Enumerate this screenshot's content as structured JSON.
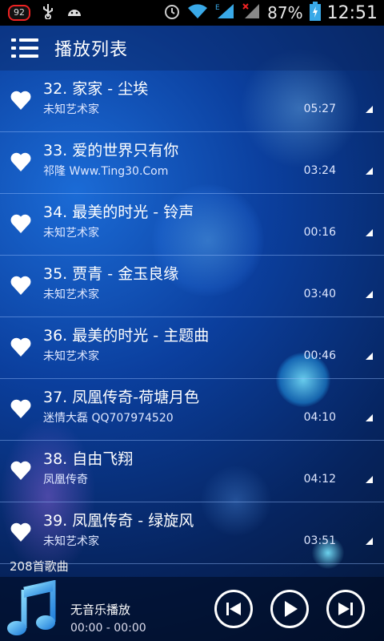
{
  "status_bar": {
    "notification_badge": "92",
    "battery_percent": "87%",
    "time": "12:51"
  },
  "header": {
    "title": "播放列表",
    "menu_icon": "list-menu-icon"
  },
  "songs": [
    {
      "title": "32. 家家 - 尘埃",
      "artist": "未知艺术家",
      "duration": "05:27"
    },
    {
      "title": "33. 爱的世界只有你",
      "artist": "祁隆 Www.Ting30.Com",
      "duration": "03:24"
    },
    {
      "title": "34. 最美的时光 - 铃声",
      "artist": "未知艺术家",
      "duration": "00:16"
    },
    {
      "title": "35. 贾青 - 金玉良缘",
      "artist": "未知艺术家",
      "duration": "03:40"
    },
    {
      "title": "36. 最美的时光 - 主题曲",
      "artist": "未知艺术家",
      "duration": "00:46"
    },
    {
      "title": "37. 凤凰传奇-荷塘月色",
      "artist": "迷情大磊 QQ707974520",
      "duration": "04:10"
    },
    {
      "title": "38. 自由飞翔",
      "artist": "凤凰传奇",
      "duration": "04:12"
    },
    {
      "title": "39. 凤凰传奇 - 绿旋风",
      "artist": "未知艺术家",
      "duration": "03:51"
    }
  ],
  "song_count": "208首歌曲",
  "player": {
    "now_playing": "无音乐播放",
    "time": "00:00 - 00:00"
  },
  "colors": {
    "accent": "#1b6bd6",
    "background_dark": "#041636"
  }
}
